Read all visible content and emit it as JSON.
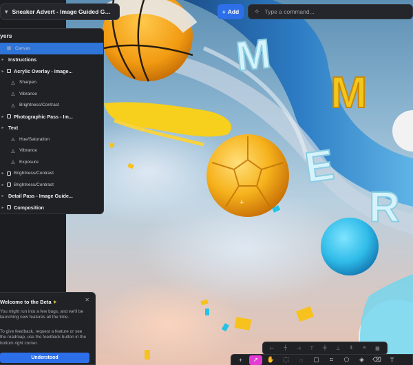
{
  "header": {
    "project_title": "Sneaker Advert - Image Guided Generati...",
    "add_label": "Add",
    "command_placeholder": "Type a command..."
  },
  "layers_panel": {
    "title": "yers",
    "items": [
      {
        "label": "Canvas",
        "icon": "canvas-icon",
        "selected": true
      },
      {
        "label": "Instructions",
        "icon": "folder-icon",
        "group": true
      },
      {
        "label": "Acrylic Overlay - Image...",
        "icon": "layer-icon",
        "group": true
      },
      {
        "label": "Sharpen",
        "icon": "adjustment-icon"
      },
      {
        "label": "Vibrance",
        "icon": "adjustment-icon"
      },
      {
        "label": "Brightness/Contrast",
        "icon": "adjustment-icon"
      },
      {
        "label": "Photographic Pass - Im...",
        "icon": "layer-icon",
        "group": true
      },
      {
        "label": "Text",
        "icon": "folder-icon",
        "group": true
      },
      {
        "label": "Hue/Saturation",
        "icon": "adjustment-icon"
      },
      {
        "label": "Vibrance",
        "icon": "adjustment-icon"
      },
      {
        "label": "Exposure",
        "icon": "adjustment-icon"
      },
      {
        "label": "Brightness/Contrast",
        "icon": "layer-icon"
      },
      {
        "label": "Brightness/Contrast",
        "icon": "layer-icon"
      },
      {
        "label": "Detail Pass - Image Guide...",
        "icon": "folder-icon",
        "group": true
      },
      {
        "label": "Composition",
        "icon": "layer-icon",
        "group": true
      }
    ]
  },
  "beta_card": {
    "title": "Welcome to the Beta",
    "paragraph1": "You might run into a few bugs, and we'll be launching new features all the time.",
    "paragraph2": "To give feedback, request a feature or see the roadmap, use the feedback button in the bottom right corner.",
    "button_label": "Understood"
  },
  "canvas_text": {
    "letters": [
      "M",
      "M",
      "E",
      "R"
    ]
  },
  "toolbar": {
    "tools": [
      "add-icon",
      "select-icon",
      "hand-icon",
      "marquee-icon",
      "lasso-icon",
      "rectangle-icon",
      "crop-icon",
      "shape-icon",
      "fill-icon",
      "eraser-icon",
      "text-icon"
    ],
    "active_tool": "select-icon"
  },
  "colors": {
    "accent": "#2d6fe8",
    "active_tool": "#e43bd3",
    "panel": "#1f2125"
  }
}
